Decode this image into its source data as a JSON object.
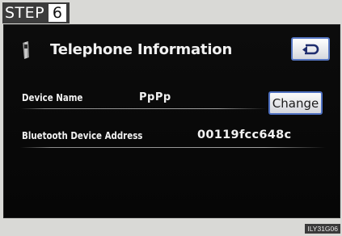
{
  "step": {
    "label": "STEP",
    "number": "6"
  },
  "screen": {
    "title": "Telephone Information",
    "header_icon": "phone-icon",
    "back_button_icon": "return-arrow-icon"
  },
  "fields": {
    "device_name": {
      "label": "Device Name",
      "value": "PpPp",
      "button_label": "Change"
    },
    "bluetooth_address": {
      "label": "Bluetooth Device Address",
      "value": "00119fcc648c"
    }
  },
  "image_code": "ILY31G06",
  "colors": {
    "button_border": "#4d6fc0",
    "screen_bg": "#0a0a0a",
    "page_bg": "#d9d9d6"
  }
}
